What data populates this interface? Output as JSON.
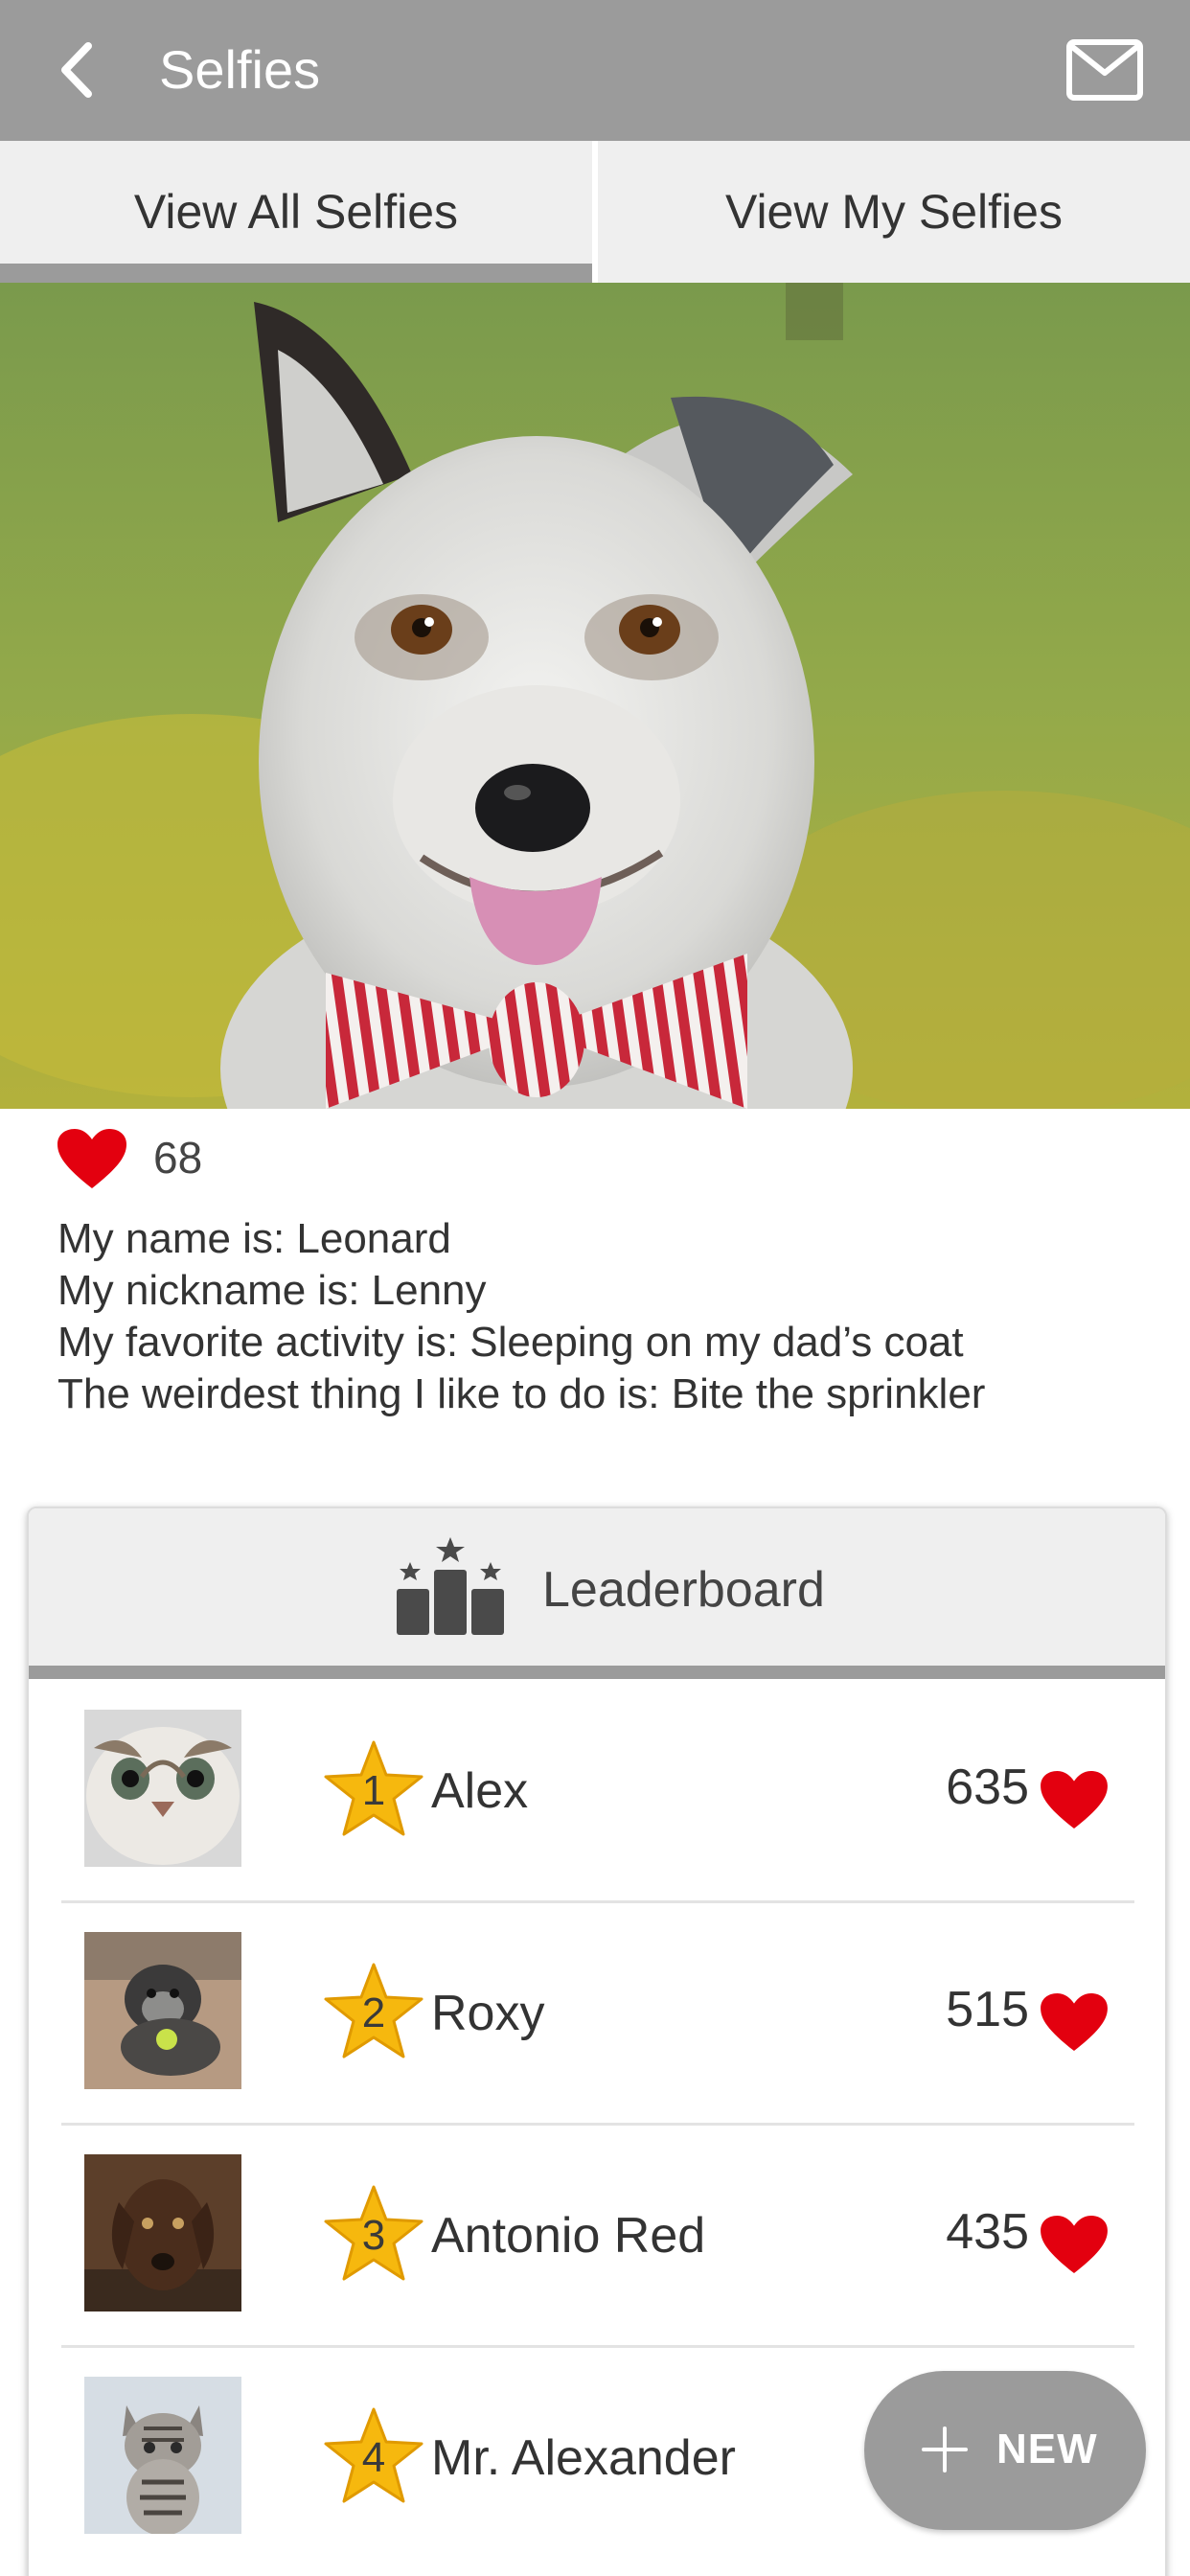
{
  "appbar": {
    "title": "Selfies",
    "back_icon": "chevron-left-icon",
    "mail_icon": "envelope-icon",
    "background": "#9b9b9b"
  },
  "tabs": [
    {
      "label": "View All Selfies",
      "selected": true
    },
    {
      "label": "View My Selfies",
      "selected": false
    }
  ],
  "photo": {
    "subject": "dog-photo"
  },
  "post": {
    "likes": "68",
    "heart_color": "#e3000f",
    "bio": [
      "My name is: Leonard",
      "My nickname is: Lenny",
      "My favorite activity is: Sleeping on my dad’s coat",
      "The weirdest thing I like to do is: Bite the sprinkler"
    ]
  },
  "leaderboard": {
    "title": "Leaderboard",
    "icon": "podium-icon",
    "rows": [
      {
        "rank": "1",
        "name": "Alex",
        "score": "635",
        "thumb": "cat-thumbnail"
      },
      {
        "rank": "2",
        "name": "Roxy",
        "score": "515",
        "thumb": "puppy-thumbnail"
      },
      {
        "rank": "3",
        "name": "Antonio Red",
        "score": "435",
        "thumb": "brown-dog-thumbnail"
      },
      {
        "rank": "4",
        "name": "Mr. Alexander",
        "score": "",
        "thumb": "kitten-thumbnail"
      }
    ]
  },
  "fab": {
    "label": "NEW",
    "icon": "plus-icon"
  }
}
